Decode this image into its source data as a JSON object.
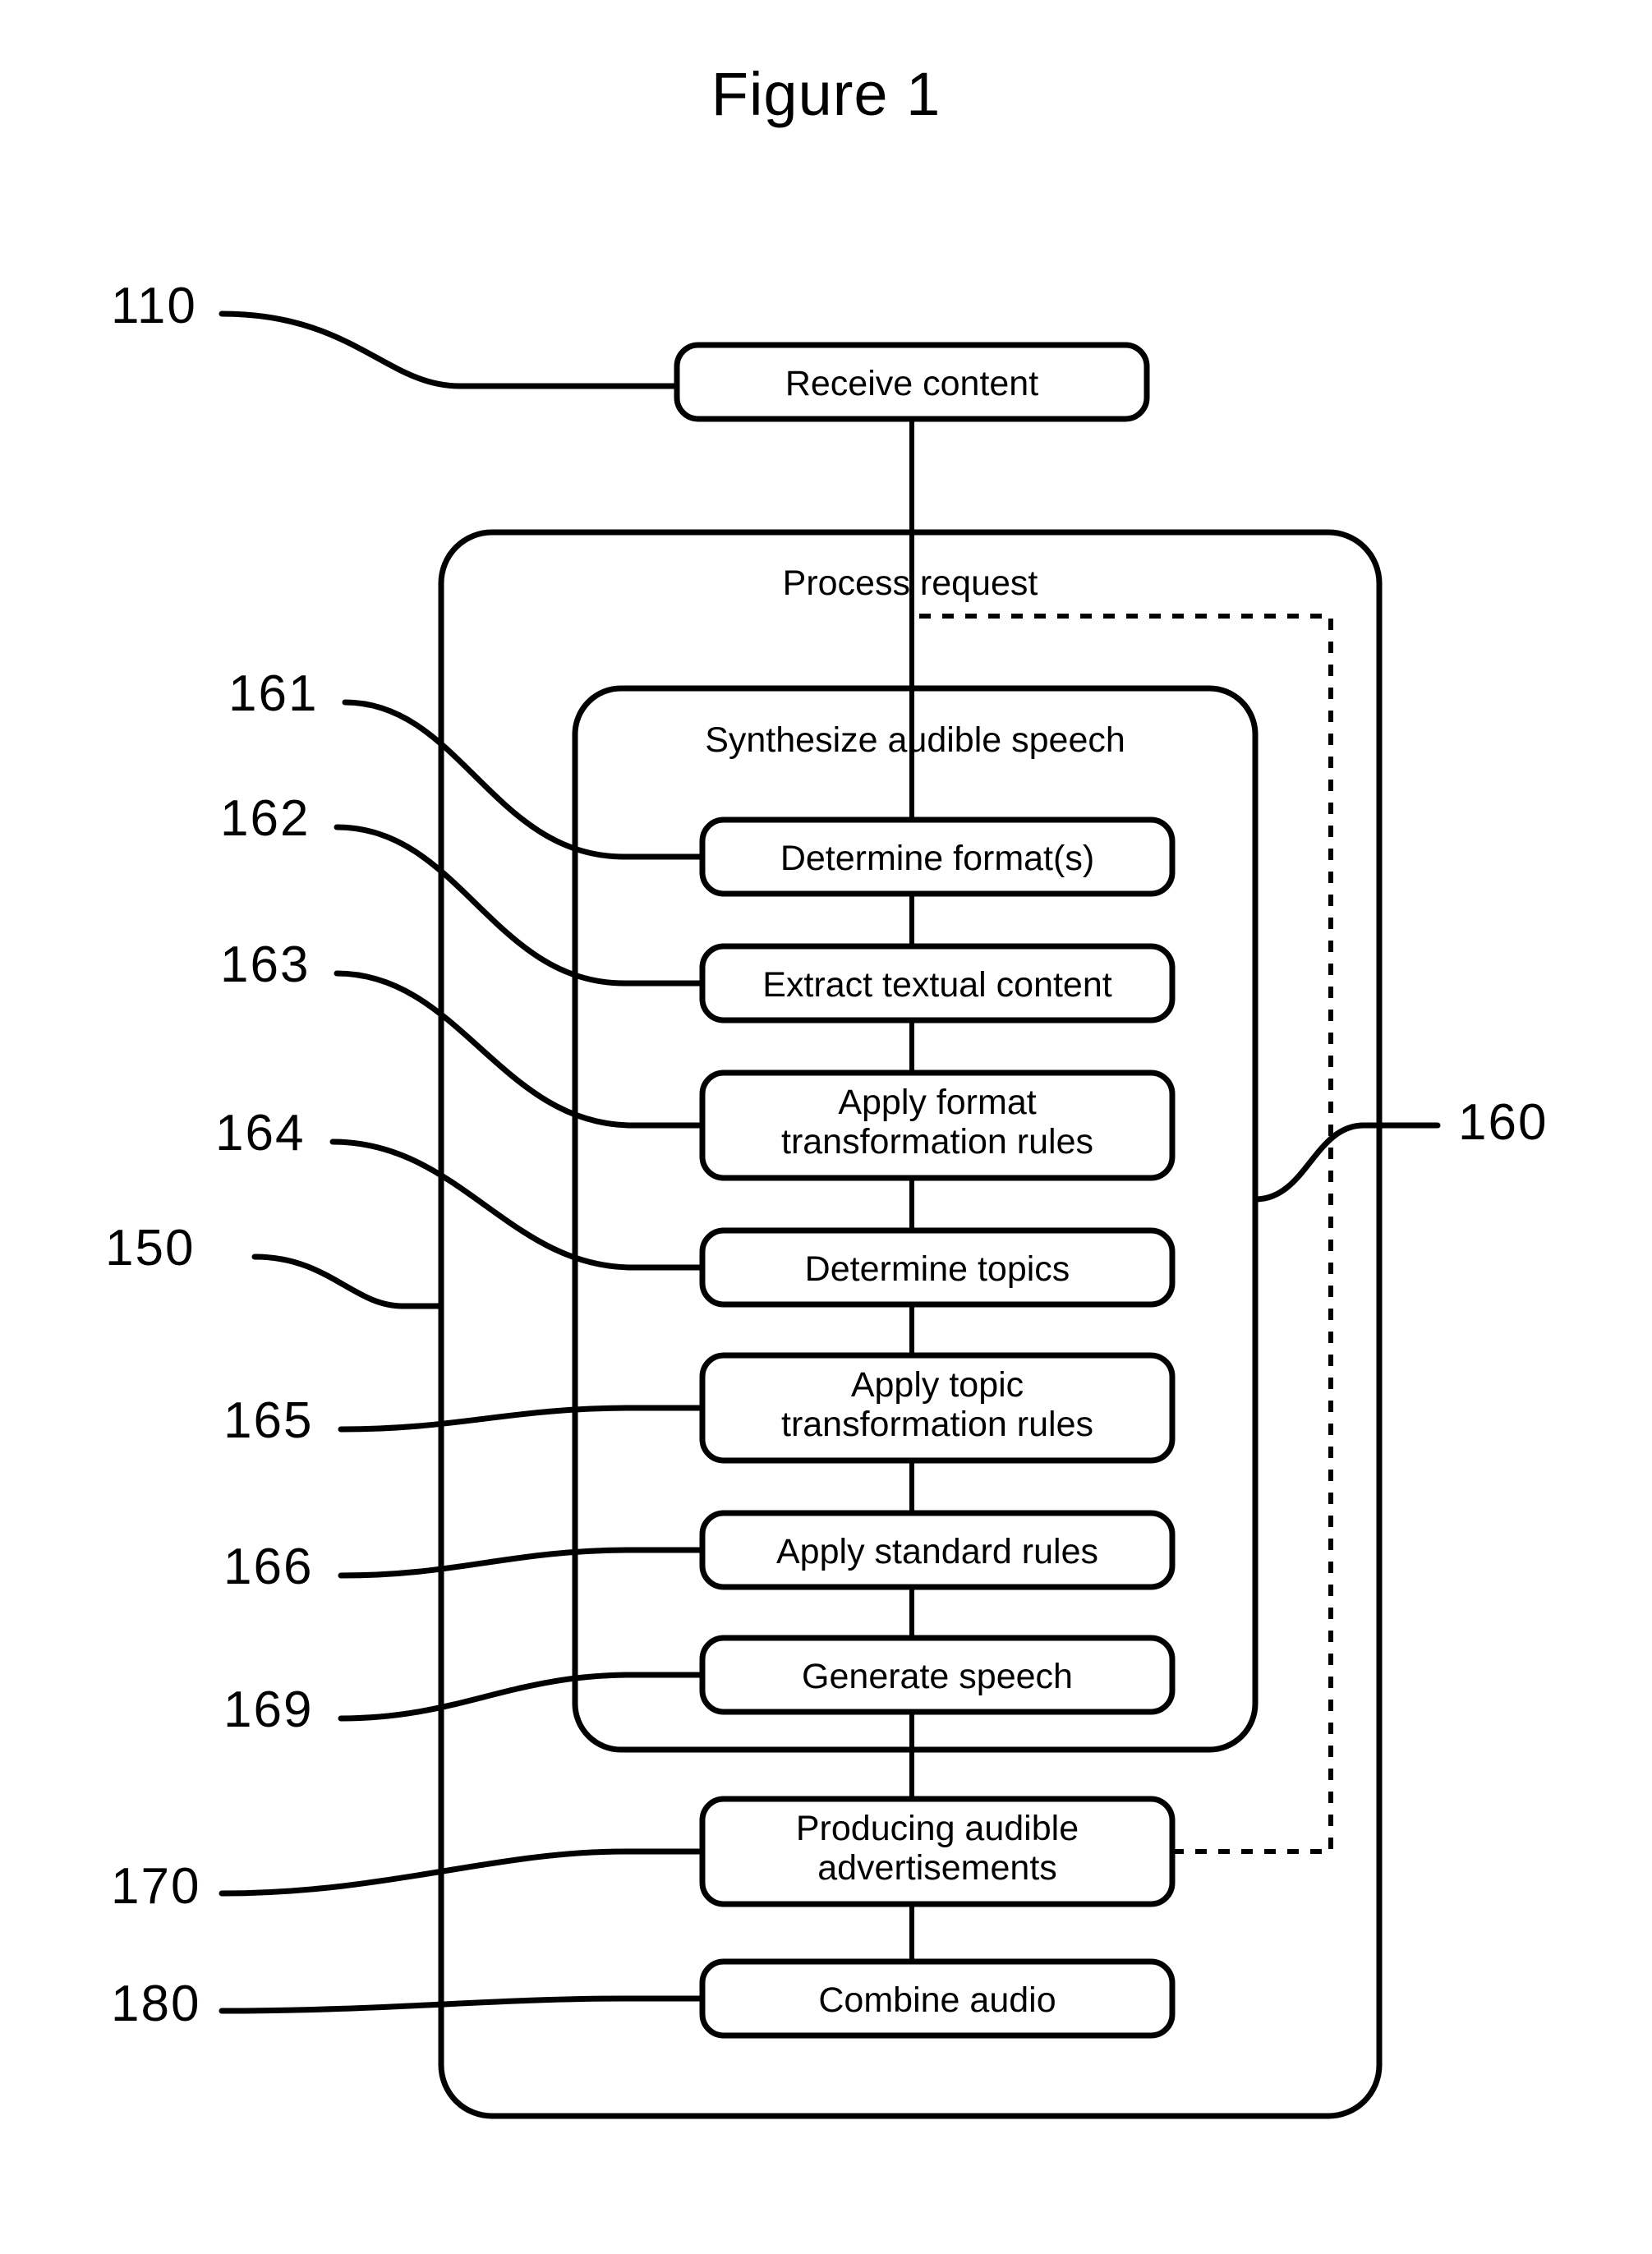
{
  "figure": {
    "title": "Figure 1",
    "line_color": "#000000",
    "background_color": "#ffffff"
  },
  "containers": [
    {
      "id": "process-request",
      "title": "Process request",
      "ref": "150",
      "style": "solid"
    },
    {
      "id": "synthesize-audible-speech",
      "title": "Synthesize audible speech",
      "ref": "160",
      "style": "solid"
    }
  ],
  "nodes": [
    {
      "id": "receive-content",
      "label": "Receive content",
      "lines": [
        "Receive content"
      ],
      "ref": "110"
    },
    {
      "id": "determine-formats",
      "label": "Determine format(s)",
      "lines": [
        "Determine format(s)"
      ],
      "ref": "161"
    },
    {
      "id": "extract-textual",
      "label": "Extract textual content",
      "lines": [
        "Extract textual content"
      ],
      "ref": "162"
    },
    {
      "id": "apply-format-rules",
      "label": "Apply format transformation rules",
      "lines": [
        "Apply format",
        "transformation rules"
      ],
      "ref": "163"
    },
    {
      "id": "determine-topics",
      "label": "Determine topics",
      "lines": [
        "Determine topics"
      ],
      "ref": "164"
    },
    {
      "id": "apply-topic-rules",
      "label": "Apply topic transformation rules",
      "lines": [
        "Apply topic",
        "transformation rules"
      ],
      "ref": "165"
    },
    {
      "id": "apply-standard-rules",
      "label": "Apply standard rules",
      "lines": [
        "Apply standard rules"
      ],
      "ref": "166"
    },
    {
      "id": "generate-speech",
      "label": "Generate speech",
      "lines": [
        "Generate speech"
      ],
      "ref": "169"
    },
    {
      "id": "producing-ads",
      "label": "Producing audible advertisements",
      "lines": [
        "Producing audible",
        "advertisements"
      ],
      "ref": "170"
    },
    {
      "id": "combine-audio",
      "label": "Combine audio",
      "lines": [
        "Combine audio"
      ],
      "ref": "180"
    }
  ],
  "reference_numerals": [
    {
      "id": "ref-110",
      "value": "110",
      "target": "receive-content"
    },
    {
      "id": "ref-161",
      "value": "161",
      "target": "determine-formats"
    },
    {
      "id": "ref-162",
      "value": "162",
      "target": "extract-textual"
    },
    {
      "id": "ref-163",
      "value": "163",
      "target": "apply-format-rules"
    },
    {
      "id": "ref-164",
      "value": "164",
      "target": "determine-topics"
    },
    {
      "id": "ref-150",
      "value": "150",
      "target": "process-request"
    },
    {
      "id": "ref-165",
      "value": "165",
      "target": "apply-topic-rules"
    },
    {
      "id": "ref-166",
      "value": "166",
      "target": "apply-standard-rules"
    },
    {
      "id": "ref-169",
      "value": "169",
      "target": "generate-speech"
    },
    {
      "id": "ref-170",
      "value": "170",
      "target": "producing-ads"
    },
    {
      "id": "ref-180",
      "value": "180",
      "target": "combine-audio"
    },
    {
      "id": "ref-160",
      "value": "160",
      "target": "synthesize-audible-speech"
    }
  ],
  "connectors": {
    "solid_flow": [
      {
        "from": "receive-content",
        "to": "process-request"
      },
      {
        "from": "process-request",
        "to": "synthesize-audible-speech"
      },
      {
        "from": "determine-formats",
        "to": "extract-textual"
      },
      {
        "from": "extract-textual",
        "to": "apply-format-rules"
      },
      {
        "from": "apply-format-rules",
        "to": "determine-topics"
      },
      {
        "from": "determine-topics",
        "to": "apply-topic-rules"
      },
      {
        "from": "apply-topic-rules",
        "to": "apply-standard-rules"
      },
      {
        "from": "apply-standard-rules",
        "to": "generate-speech"
      },
      {
        "from": "generate-speech",
        "to": "producing-ads"
      },
      {
        "from": "producing-ads",
        "to": "combine-audio"
      }
    ],
    "dashed_feedback": [
      {
        "from": "producing-ads",
        "to": "synthesize-audible-speech",
        "style": "dashed"
      }
    ]
  }
}
